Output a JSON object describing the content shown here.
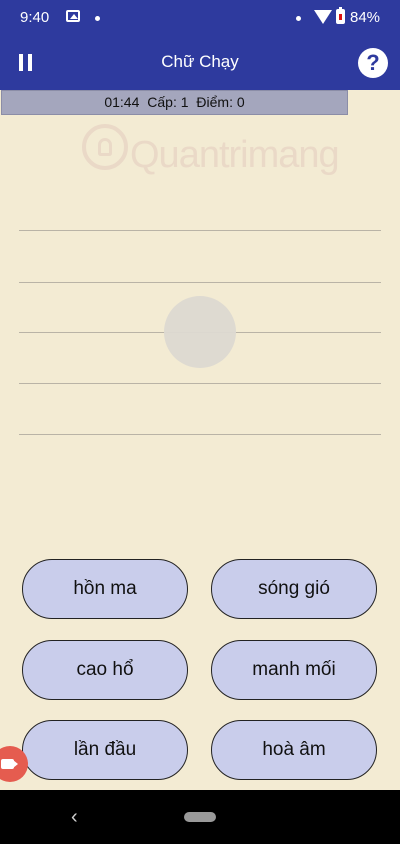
{
  "status": {
    "time": "9:40",
    "battery": "84%"
  },
  "appbar": {
    "title": "Chữ Chạy",
    "help_label": "?"
  },
  "info": {
    "timer": "01:44",
    "level": "Cấp: 1",
    "score": "Điểm: 0"
  },
  "watermark": {
    "text": "Quantrimang"
  },
  "answers": [
    {
      "label": "hồn ma"
    },
    {
      "label": "sóng gió"
    },
    {
      "label": "cao hổ"
    },
    {
      "label": "manh mối"
    },
    {
      "label": "lần đầu"
    },
    {
      "label": "hoà âm"
    }
  ],
  "nav": {
    "back": "‹"
  },
  "colors": {
    "primary": "#2e3a9e",
    "background": "#f3ebd3",
    "answer_fill": "#c9cdeb",
    "record_button": "#e55c4f"
  }
}
